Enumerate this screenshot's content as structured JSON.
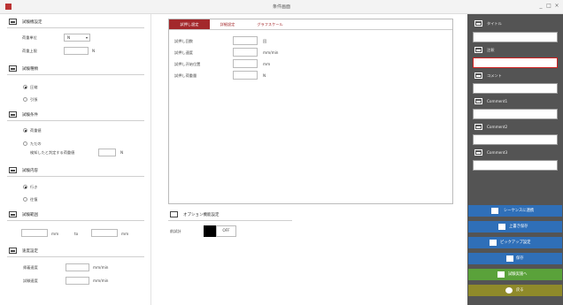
{
  "window": {
    "title": "条件画面",
    "controls": [
      "_",
      "□",
      "×"
    ]
  },
  "test_settings": {
    "header": "試験機設定",
    "load_unit_label": "荷重単位",
    "load_unit_value": "N",
    "max_load_label": "荷重上限",
    "max_load_unit": "N"
  },
  "test_mode": {
    "header": "試験種類",
    "options": [
      "圧縮",
      "引張"
    ]
  },
  "test_condition": {
    "header": "試験条件",
    "options": [
      "荷重値",
      "ただの"
    ],
    "detect_label": "検知したと判定する荷重値",
    "detect_unit": "N"
  },
  "test_content": {
    "header": "試験内容",
    "options": [
      "行き",
      "往復"
    ]
  },
  "test_range": {
    "header": "試験範囲",
    "unit_from": "mm",
    "sep": "to",
    "unit_to": "mm"
  },
  "speed_settings": {
    "header": "速度設定",
    "return_speed_label": "帰着速度",
    "return_speed_unit": "mm/min",
    "test_speed_label": "試験速度",
    "test_speed_unit": "mm/min"
  },
  "tabs": {
    "items": [
      "試押し設定",
      "詳細設定",
      "グラフスケール"
    ]
  },
  "press_settings": {
    "rows": [
      {
        "label": "試押し回数",
        "unit": "回"
      },
      {
        "label": "試押し速度",
        "unit": "mm/min"
      },
      {
        "label": "試押し开始位置",
        "unit": "mm"
      },
      {
        "label": "試押し荷重量",
        "unit": "N"
      }
    ]
  },
  "options": {
    "header": "オプション機能設定",
    "toggle_label": "前試計",
    "toggle_value": "OFF"
  },
  "right_panel": {
    "fields": [
      "タイトル",
      "注釈",
      "コメント",
      "Comment1",
      "Comment2",
      "Comment3"
    ]
  },
  "actions": {
    "sequence": "シーケンスに連携",
    "overwrite": "上書き保存",
    "pickup": "ピックアップ設定",
    "save": "保存",
    "go_test": "試験実施へ",
    "back": "戻る"
  }
}
